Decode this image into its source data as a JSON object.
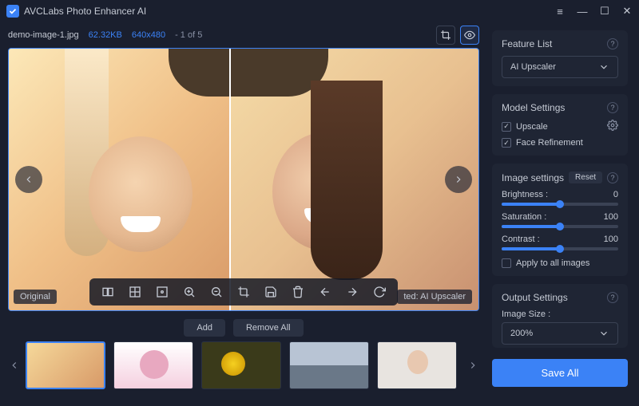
{
  "app": {
    "title": "AVCLabs Photo Enhancer AI"
  },
  "file": {
    "name": "demo-image-1.jpg",
    "size": "62.32KB",
    "resolution": "640x480",
    "position": "- 1 of 5"
  },
  "viewer": {
    "original_label": "Original",
    "applied_label": "ted: AI Upscaler"
  },
  "actions": {
    "add": "Add",
    "remove_all": "Remove All",
    "save_all": "Save All"
  },
  "feature_list": {
    "title": "Feature List",
    "selected": "AI Upscaler"
  },
  "model_settings": {
    "title": "Model Settings",
    "upscale": "Upscale",
    "upscale_checked": true,
    "face_refinement": "Face Refinement",
    "face_refinement_checked": true
  },
  "image_settings": {
    "title": "Image settings",
    "reset": "Reset",
    "brightness_label": "Brightness :",
    "brightness_value": "0",
    "brightness_pct": 50,
    "saturation_label": "Saturation :",
    "saturation_value": "100",
    "saturation_pct": 50,
    "contrast_label": "Contrast :",
    "contrast_value": "100",
    "contrast_pct": 50,
    "apply_all": "Apply to all images",
    "apply_all_checked": false
  },
  "output_settings": {
    "title": "Output Settings",
    "image_size_label": "Image Size :",
    "image_size_value": "200%"
  }
}
